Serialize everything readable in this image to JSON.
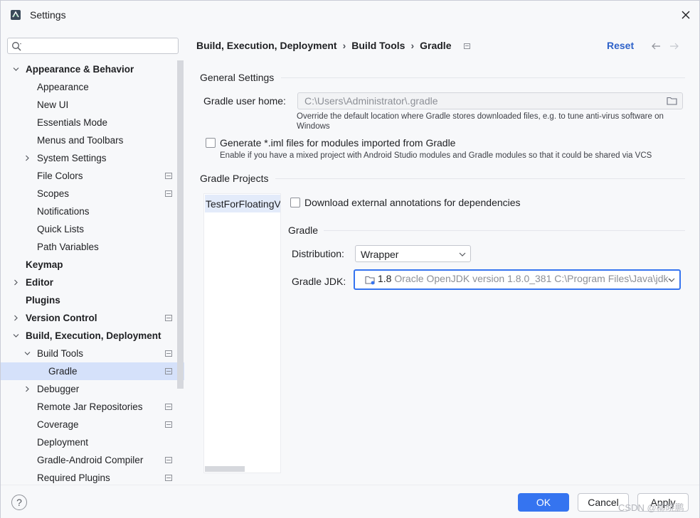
{
  "window": {
    "title": "Settings"
  },
  "sidebar": {
    "search_placeholder": "",
    "items": [
      {
        "label": "Appearance & Behavior",
        "level": 0,
        "bold": true,
        "chevron": "expanded",
        "project": false
      },
      {
        "label": "Appearance",
        "level": 1,
        "bold": false,
        "chevron": "none",
        "project": false
      },
      {
        "label": "New UI",
        "level": 1,
        "bold": false,
        "chevron": "none",
        "project": false
      },
      {
        "label": "Essentials Mode",
        "level": 1,
        "bold": false,
        "chevron": "none",
        "project": false
      },
      {
        "label": "Menus and Toolbars",
        "level": 1,
        "bold": false,
        "chevron": "none",
        "project": false
      },
      {
        "label": "System Settings",
        "level": 1,
        "bold": false,
        "chevron": "collapsed",
        "project": false
      },
      {
        "label": "File Colors",
        "level": 1,
        "bold": false,
        "chevron": "none",
        "project": true
      },
      {
        "label": "Scopes",
        "level": 1,
        "bold": false,
        "chevron": "none",
        "project": true
      },
      {
        "label": "Notifications",
        "level": 1,
        "bold": false,
        "chevron": "none",
        "project": false
      },
      {
        "label": "Quick Lists",
        "level": 1,
        "bold": false,
        "chevron": "none",
        "project": false
      },
      {
        "label": "Path Variables",
        "level": 1,
        "bold": false,
        "chevron": "none",
        "project": false
      },
      {
        "label": "Keymap",
        "level": 0,
        "bold": true,
        "chevron": "none",
        "project": false
      },
      {
        "label": "Editor",
        "level": 0,
        "bold": true,
        "chevron": "collapsed",
        "project": false
      },
      {
        "label": "Plugins",
        "level": 0,
        "bold": true,
        "chevron": "none",
        "project": false
      },
      {
        "label": "Version Control",
        "level": 0,
        "bold": true,
        "chevron": "collapsed",
        "project": true
      },
      {
        "label": "Build, Execution, Deployment",
        "level": 0,
        "bold": true,
        "chevron": "expanded",
        "project": false
      },
      {
        "label": "Build Tools",
        "level": 1,
        "bold": false,
        "chevron": "expanded",
        "project": true
      },
      {
        "label": "Gradle",
        "level": 2,
        "bold": false,
        "chevron": "none",
        "project": true,
        "selected": true
      },
      {
        "label": "Debugger",
        "level": 1,
        "bold": false,
        "chevron": "collapsed",
        "project": false
      },
      {
        "label": "Remote Jar Repositories",
        "level": 1,
        "bold": false,
        "chevron": "none",
        "project": true
      },
      {
        "label": "Coverage",
        "level": 1,
        "bold": false,
        "chevron": "none",
        "project": true
      },
      {
        "label": "Deployment",
        "level": 1,
        "bold": false,
        "chevron": "none",
        "project": false
      },
      {
        "label": "Gradle-Android Compiler",
        "level": 1,
        "bold": false,
        "chevron": "none",
        "project": true
      },
      {
        "label": "Required Plugins",
        "level": 1,
        "bold": false,
        "chevron": "none",
        "project": true
      }
    ]
  },
  "breadcrumb": {
    "parts": [
      "Build, Execution, Deployment",
      "Build Tools",
      "Gradle"
    ],
    "reset": "Reset"
  },
  "general": {
    "title": "General Settings",
    "gradle_home_label": "Gradle user home:",
    "gradle_home_value": "C:\\Users\\Administrator\\.gradle",
    "gradle_home_hint_1": "Override the default location where Gradle stores downloaded files, e.g. to tune anti-virus software on",
    "gradle_home_hint_2": "Windows",
    "iml_label": "Generate *.iml files for modules imported from Gradle",
    "iml_hint": "Enable if you have a mixed project with Android Studio modules and Gradle modules so that it could be shared via VCS"
  },
  "projects": {
    "title": "Gradle Projects",
    "selected_project": "TestForFloatingV",
    "download_annotations_label": "Download external annotations for dependencies",
    "gradle_section": "Gradle",
    "distribution_label": "Distribution:",
    "distribution_value": "Wrapper",
    "jdk_label": "Gradle JDK:",
    "jdk_version": "1.8",
    "jdk_desc": "Oracle OpenJDK version 1.8.0_381 C:\\Program Files\\Java\\jdk-"
  },
  "footer": {
    "help": "?",
    "ok": "OK",
    "cancel": "Cancel",
    "apply": "Apply",
    "watermark": "CSDN @柳晓鹏"
  },
  "colors": {
    "accent": "#3574f0",
    "selected_bg": "#d5e1fa",
    "link": "#2e62c9"
  }
}
